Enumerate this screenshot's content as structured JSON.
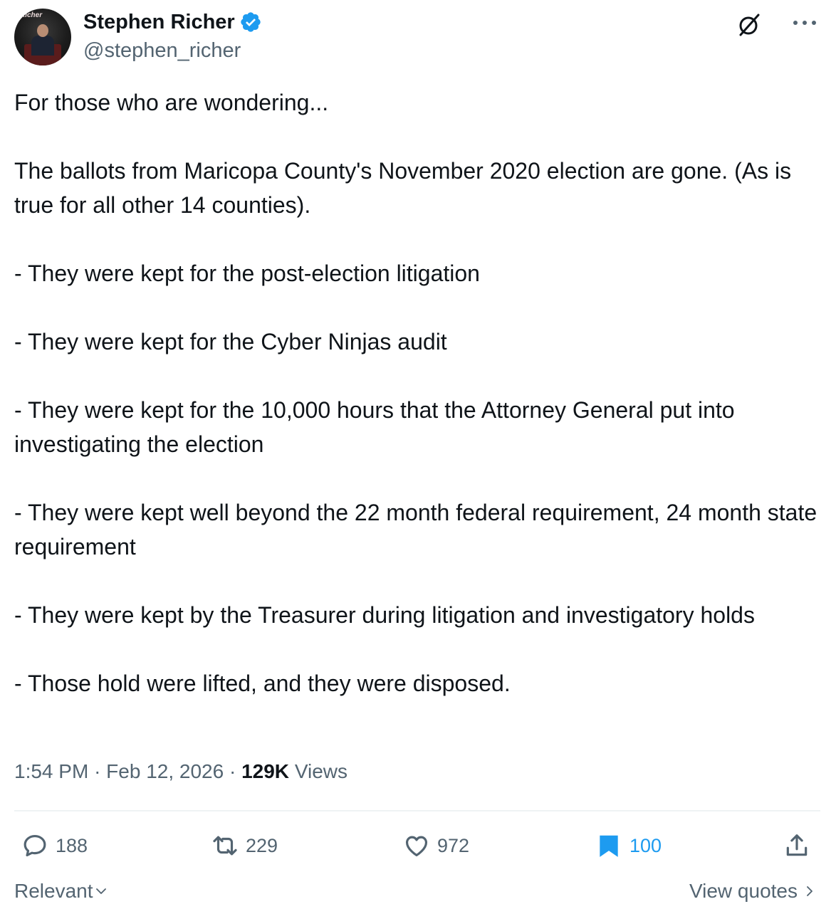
{
  "author": {
    "display_name": "Stephen Richer",
    "handle": "@stephen_richer",
    "verified": true,
    "avatar_text": "Richer"
  },
  "tweet": {
    "paragraphs": [
      "For those who are wondering...",
      "The ballots from Maricopa County's November 2020 election are gone. (As is true for all other 14 counties).",
      "- They were kept for the post-election litigation",
      "- They were kept for the Cyber Ninjas audit",
      "- They were kept for the 10,000 hours that the Attorney General put into investigating the election",
      "- They were kept well beyond the 22 month federal requirement, 24 month state requirement",
      "- They were kept by the Treasurer during litigation and investigatory holds",
      "- Those hold were lifted, and they were disposed."
    ],
    "time": "1:54 PM",
    "date": "Feb 12, 2026",
    "separator": "·",
    "views_count": "129K",
    "views_label": "Views"
  },
  "actions": {
    "replies": "188",
    "reposts": "229",
    "likes": "972",
    "bookmarks": "100"
  },
  "footer": {
    "sort_label": "Relevant",
    "view_quotes_label": "View quotes"
  },
  "icons": {
    "verified": "verified-badge-icon",
    "grok": "grok-icon",
    "more": "more-icon",
    "reply": "reply-icon",
    "repost": "repost-icon",
    "like": "heart-icon",
    "bookmark": "bookmark-filled-icon",
    "share": "share-icon"
  },
  "colors": {
    "accent": "#1d9bf0",
    "text_primary": "#0f1419",
    "text_secondary": "#536471",
    "divider": "#eff3f4"
  }
}
